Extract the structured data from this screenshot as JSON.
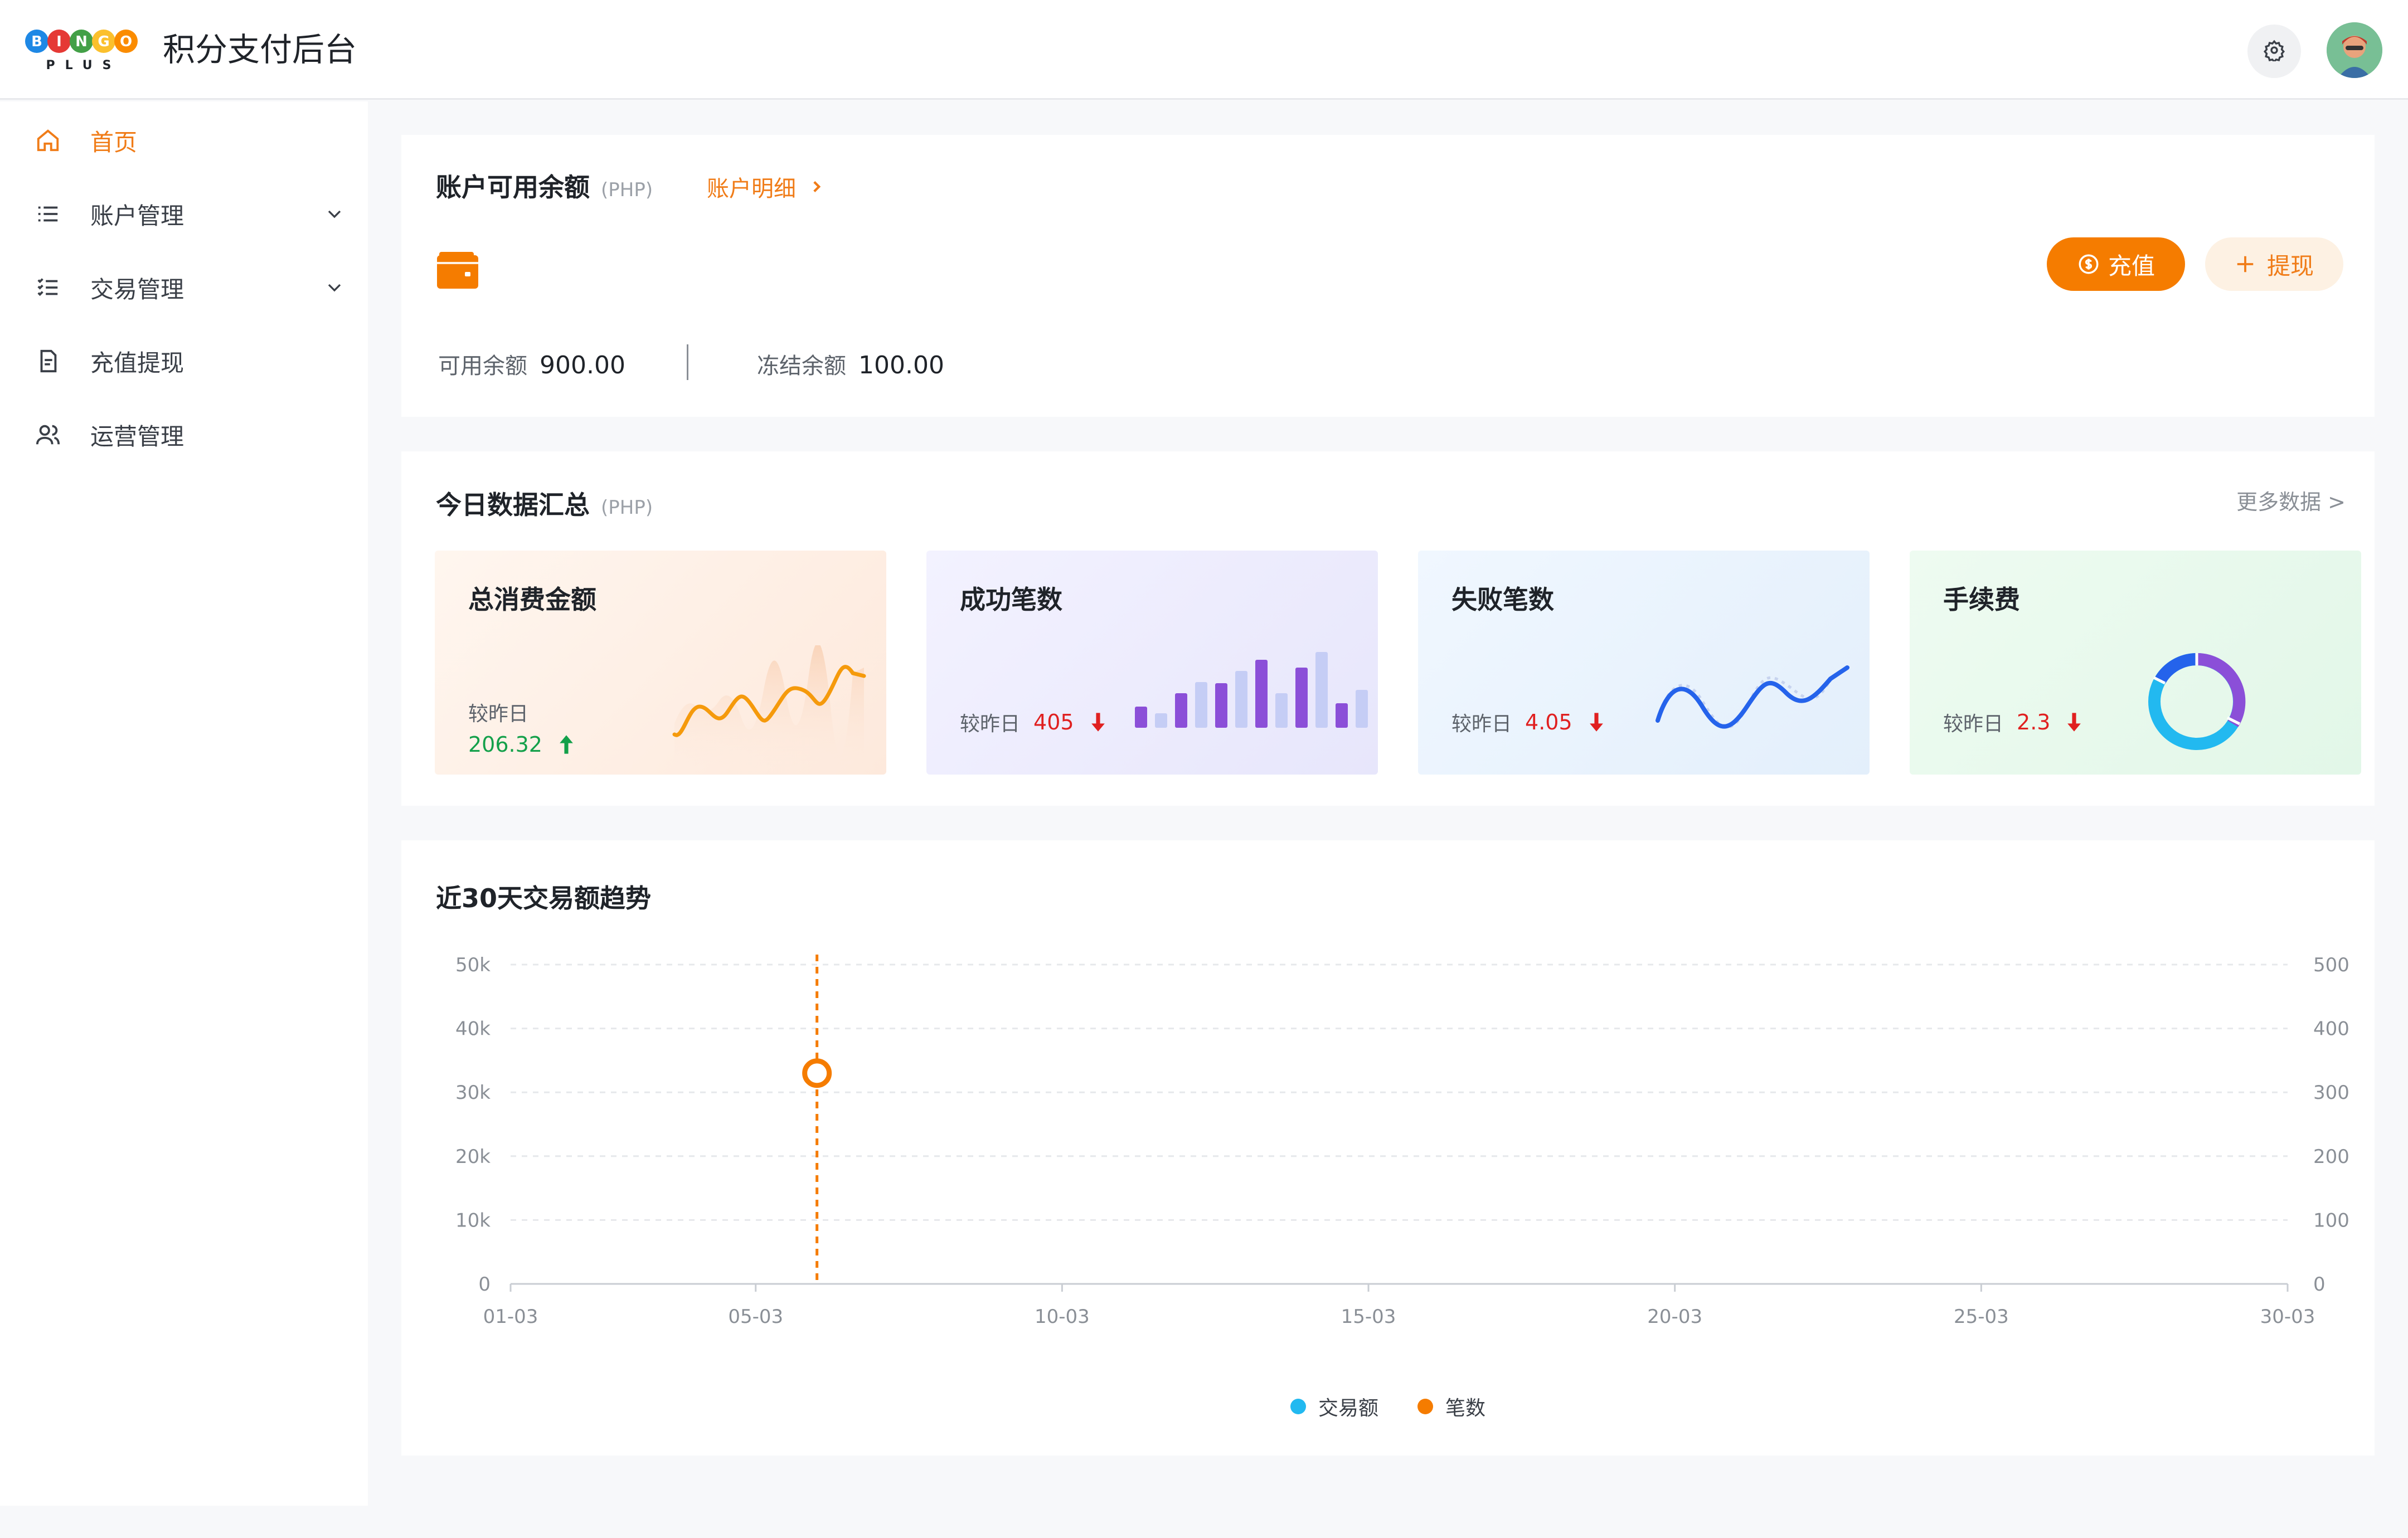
{
  "header": {
    "logo_text": "BINGO PLUS",
    "title": "积分支付后台",
    "settings_icon": "gear-icon",
    "avatar_icon": "user-avatar"
  },
  "sidebar": {
    "items": [
      {
        "label": "首页",
        "icon": "home-icon",
        "active": true,
        "expandable": false
      },
      {
        "label": "账户管理",
        "icon": "list-icon",
        "active": false,
        "expandable": true
      },
      {
        "label": "交易管理",
        "icon": "checklist-icon",
        "active": false,
        "expandable": true
      },
      {
        "label": "充值提现",
        "icon": "document-icon",
        "active": false,
        "expandable": false
      },
      {
        "label": "运营管理",
        "icon": "users-icon",
        "active": false,
        "expandable": false
      }
    ],
    "collapse_icon": "collapse-menu-icon"
  },
  "balance": {
    "title": "账户可用余额",
    "unit": "(PHP)",
    "detail_link": "账户明细",
    "recharge_label": "充值",
    "withdraw_label": "提现",
    "available_label": "可用余额",
    "available_value": "900.00",
    "frozen_label": "冻结余额",
    "frozen_value": "100.00"
  },
  "today": {
    "title": "今日数据汇总",
    "unit": "(PHP)",
    "more_link": "更多数据 >",
    "stats": [
      {
        "title": "总消费金额",
        "compare_label": "较昨日",
        "compare_value": "206.32",
        "direction": "up",
        "color": "#13a04a",
        "graph": "line"
      },
      {
        "title": "成功笔数",
        "compare_label": "较昨日",
        "compare_value": "405",
        "direction": "down",
        "color": "#e02020",
        "graph": "bars"
      },
      {
        "title": "失败笔数",
        "compare_label": "较昨日",
        "compare_value": "4.05",
        "direction": "down",
        "color": "#e02020",
        "graph": "wave"
      },
      {
        "title": "手续费",
        "compare_label": "较昨日",
        "compare_value": "2.3",
        "direction": "down",
        "color": "#e02020",
        "graph": "donut"
      }
    ]
  },
  "trend": {
    "title": "近30天交易额趋势",
    "legend": [
      {
        "label": "交易额",
        "color": "#22b9f0"
      },
      {
        "label": "笔数",
        "color": "#f57c00"
      }
    ]
  },
  "chart_data": {
    "type": "line",
    "x": [
      "01-03",
      "05-03",
      "10-03",
      "15-03",
      "20-03",
      "25-03",
      "30-03"
    ],
    "yticks_left": [
      "0",
      "10k",
      "20k",
      "30k",
      "40k",
      "50k"
    ],
    "yticks_right": [
      "0",
      "100",
      "200",
      "300",
      "400",
      "500"
    ],
    "ylim_left": [
      0,
      50000
    ],
    "ylim_right": [
      0,
      500
    ],
    "series": [
      {
        "name": "交易额",
        "axis": "left",
        "points": []
      },
      {
        "name": "笔数",
        "axis": "right",
        "points": [
          {
            "x": "06-03",
            "y": 330
          }
        ]
      }
    ],
    "crosshair_x": "06-03",
    "grid": true,
    "legend_position": "bottom"
  }
}
